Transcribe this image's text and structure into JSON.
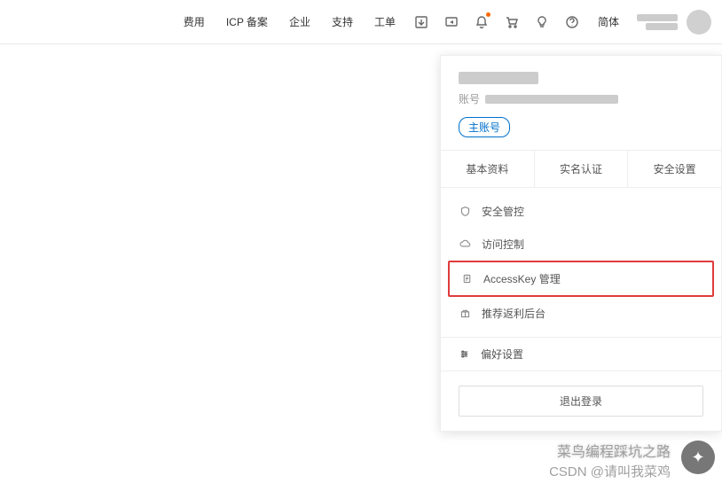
{
  "header": {
    "nav": {
      "fee": "费用",
      "icp": "ICP 备案",
      "enterprise": "企业",
      "support": "支持",
      "worksheet": "工单"
    },
    "lang": "简体"
  },
  "dropdown": {
    "account_label": "账号",
    "main_badge": "主账号",
    "tabs": {
      "profile": "基本资料",
      "realname": "实名认证",
      "security": "安全设置"
    },
    "items": {
      "security_ctrl": "安全管控",
      "access_ctrl": "访问控制",
      "accesskey": "AccessKey 管理",
      "rebate": "推荐返利后台"
    },
    "preference": "偏好设置",
    "logout": "退出登录"
  },
  "watermark": {
    "line1": "菜鸟编程踩坑之路",
    "line2": "CSDN @请叫我菜鸡"
  }
}
